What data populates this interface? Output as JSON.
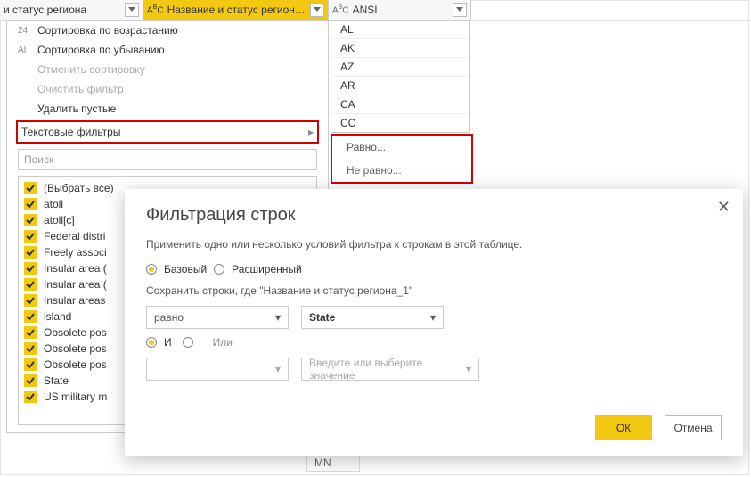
{
  "columns": {
    "col1": {
      "label": "и статус региона",
      "type_icon": ""
    },
    "col2": {
      "label": "Название и статус региона_1",
      "type_icon": "AᴮC"
    },
    "col3": {
      "label": "ANSI",
      "type_icon": "AᴮC"
    }
  },
  "ansi_values": [
    "AL",
    "AK",
    "AZ",
    "AR",
    "CA",
    "CC"
  ],
  "text_filter_menu": {
    "equals": "Равно...",
    "not_equals": "Не равно..."
  },
  "filter_panel": {
    "sort_asc_prefix": "24",
    "sort_asc": "Сортировка по возрастанию",
    "sort_desc_prefix": "AI",
    "sort_desc": "Сортировка по убыванию",
    "clear_sort": "Отменить сортировку",
    "clear_filter": "Очистить фильтр",
    "remove_empty": "Удалить пустые",
    "text_filters": "Текстовые фильтры",
    "search_placeholder": "Поиск",
    "values": [
      "(Выбрать все)",
      "atoll",
      "atoll[c]",
      "Federal distri",
      "Freely associ",
      "Insular area (",
      "Insular area (",
      "Insular areas",
      "island",
      "Obsolete pos",
      "Obsolete pos",
      "Obsolete pos",
      "State",
      "US military m"
    ]
  },
  "dialog": {
    "title": "Фильтрация строк",
    "desc": "Применить одно или несколько условий фильтра к строкам в этой таблице.",
    "mode_basic": "Базовый",
    "mode_advanced": "Расширенный",
    "keep_rows_prefix": "Сохранить строки, где \"",
    "keep_rows_col": "Название и статус региона_1",
    "keep_rows_suffix": "\"",
    "op1": "равно",
    "val1": "State",
    "logic_and": "И",
    "logic_or": "Или",
    "op2": "",
    "val2_placeholder": "Введите или выберите значение",
    "ok": "ОК",
    "cancel": "Отмена"
  },
  "bottom_cell": "MN"
}
